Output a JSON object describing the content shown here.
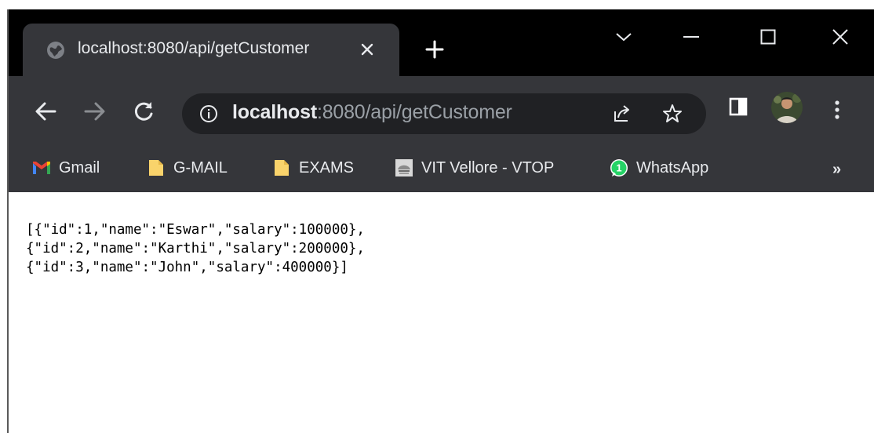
{
  "tab": {
    "title": "localhost:8080/api/getCustomer",
    "close_icon": "close-icon",
    "favicon": "globe-icon"
  },
  "new_tab_icon": "plus-icon",
  "window_controls": [
    "chevron-down-icon",
    "minimize-icon",
    "maximize-icon",
    "close-icon"
  ],
  "toolbar": {
    "icons": [
      "back-arrow-icon",
      "forward-arrow-icon",
      "reload-icon"
    ]
  },
  "omnibox": {
    "host": "localhost",
    "rest": ":8080/api/getCustomer",
    "info_icon": "info-icon",
    "share_icon": "share-icon",
    "star_icon": "star-icon"
  },
  "bookmarks": [
    {
      "label": "Gmail",
      "icon": "gmail-icon"
    },
    {
      "label": "G-MAIL",
      "icon": "folder-icon"
    },
    {
      "label": "EXAMS",
      "icon": "folder-icon"
    },
    {
      "label": "VIT Vellore - VTOP",
      "icon": "vit-logo-icon"
    },
    {
      "label": "WhatsApp",
      "icon": "whatsapp-icon",
      "badge": "1"
    }
  ],
  "bookmarks_more": "»",
  "json_lines": [
    "[{\"id\":1,\"name\":\"Eswar\",\"salary\":100000},",
    "{\"id\":2,\"name\":\"Karthi\",\"salary\":200000},",
    "{\"id\":3,\"name\":\"John\",\"salary\":400000}]"
  ],
  "colors": {
    "tabstrip": "#000000",
    "toolbar": "#35363a",
    "omnibox": "#202124",
    "text_light": "#e8eaed",
    "folder": "#f9d36b",
    "whatsapp": "#25d366"
  }
}
